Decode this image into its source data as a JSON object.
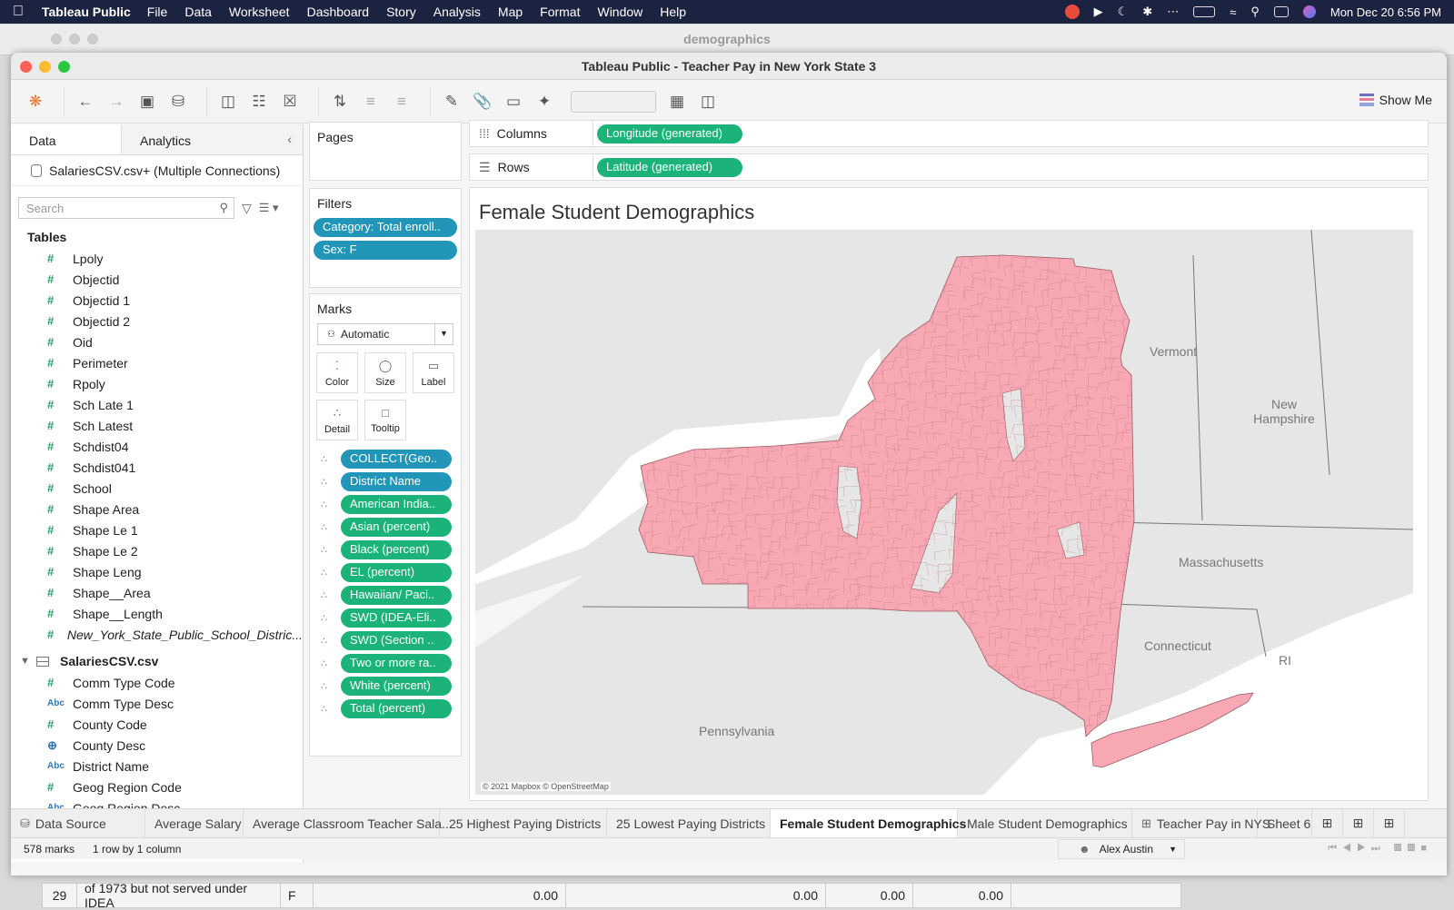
{
  "menubar": {
    "app": "Tableau Public",
    "items": [
      "File",
      "Data",
      "Worksheet",
      "Dashboard",
      "Story",
      "Analysis",
      "Map",
      "Format",
      "Window",
      "Help"
    ],
    "datetime": "Mon Dec 20  6:56 PM"
  },
  "back_window": {
    "title": "demographics"
  },
  "window": {
    "title": "Tableau Public - Teacher Pay in New York State 3"
  },
  "toolbar": {
    "show_me": "Show Me"
  },
  "left": {
    "tabs": {
      "data": "Data",
      "analytics": "Analytics"
    },
    "connection": "SalariesCSV.csv+ (Multiple Connections)",
    "search_placeholder": "Search",
    "tables_label": "Tables",
    "fields": [
      {
        "icon": "#",
        "name": "Lpoly"
      },
      {
        "icon": "#",
        "name": "Objectid"
      },
      {
        "icon": "#",
        "name": "Objectid 1"
      },
      {
        "icon": "#",
        "name": "Objectid 2"
      },
      {
        "icon": "#",
        "name": "Oid"
      },
      {
        "icon": "#",
        "name": "Perimeter"
      },
      {
        "icon": "#",
        "name": "Rpoly"
      },
      {
        "icon": "#",
        "name": "Sch Late 1"
      },
      {
        "icon": "#",
        "name": "Sch Latest"
      },
      {
        "icon": "#",
        "name": "Schdist04"
      },
      {
        "icon": "#",
        "name": "Schdist041"
      },
      {
        "icon": "#",
        "name": "School"
      },
      {
        "icon": "#",
        "name": "Shape Area"
      },
      {
        "icon": "#",
        "name": "Shape Le 1"
      },
      {
        "icon": "#",
        "name": "Shape Le 2"
      },
      {
        "icon": "#",
        "name": "Shape Leng"
      },
      {
        "icon": "#",
        "name": "Shape__Area"
      },
      {
        "icon": "#",
        "name": "Shape__Length"
      },
      {
        "icon": "#",
        "name": "New_York_State_Public_School_Distric..."
      }
    ],
    "group2": "SalariesCSV.csv",
    "fields2": [
      {
        "icon": "#",
        "name": "Comm Type Code"
      },
      {
        "icon": "Abc",
        "name": "Comm Type Desc"
      },
      {
        "icon": "#",
        "name": "County Code"
      },
      {
        "icon": "globe",
        "name": "County Desc"
      },
      {
        "icon": "Abc",
        "name": "District Name"
      },
      {
        "icon": "#",
        "name": "Geog Region Code"
      },
      {
        "icon": "Abc",
        "name": "Geog Region Desc"
      }
    ]
  },
  "cards": {
    "pages": "Pages",
    "filters": "Filters",
    "filter_pills": [
      "Category: Total enroll..",
      "Sex: F"
    ],
    "marks": "Marks",
    "mark_type": "Automatic",
    "mark_buttons": [
      "Color",
      "Size",
      "Label",
      "Detail",
      "Tooltip"
    ],
    "mark_pills": [
      "COLLECT(Geo..",
      "District Name",
      "American India..",
      "Asian (percent)",
      "Black (percent)",
      "EL (percent)",
      "Hawaiian/ Paci..",
      "SWD (IDEA-Eli..",
      "SWD (Section ..",
      "Two or more ra..",
      "White (percent)",
      "Total (percent)"
    ]
  },
  "shelves": {
    "columns_label": "Columns",
    "columns_pill": "Longitude (generated)",
    "rows_label": "Rows",
    "rows_pill": "Latitude (generated)"
  },
  "view": {
    "title": "Female Student Demographics",
    "state_labels": [
      "Vermont",
      "New Hampshire",
      "Massachusetts",
      "Connecticut",
      "RI",
      "Pennsylvania"
    ],
    "attribution": "© 2021 Mapbox © OpenStreetMap",
    "fill_color": "#f7a8b2"
  },
  "sheet_tabs": {
    "data_source": "Data Source",
    "tabs": [
      "Average Salary",
      "Average Classroom Teacher Sala...",
      "25 Highest Paying Districts",
      "25 Lowest Paying Districts",
      "Female Student Demographics",
      "Male Student Demographics",
      "Teacher Pay in NYS",
      "Sheet 6"
    ],
    "active": "Female Student Demographics"
  },
  "status": {
    "marks": "578 marks",
    "dims": "1 row by 1 column",
    "user": "Alex Austin"
  },
  "bottom_row": {
    "num": "29",
    "text": "of 1973 but not served under IDEA",
    "sex": "F",
    "v1": "0.00",
    "v2": "0.00",
    "v3": "0.00",
    "v4": "0.00"
  }
}
